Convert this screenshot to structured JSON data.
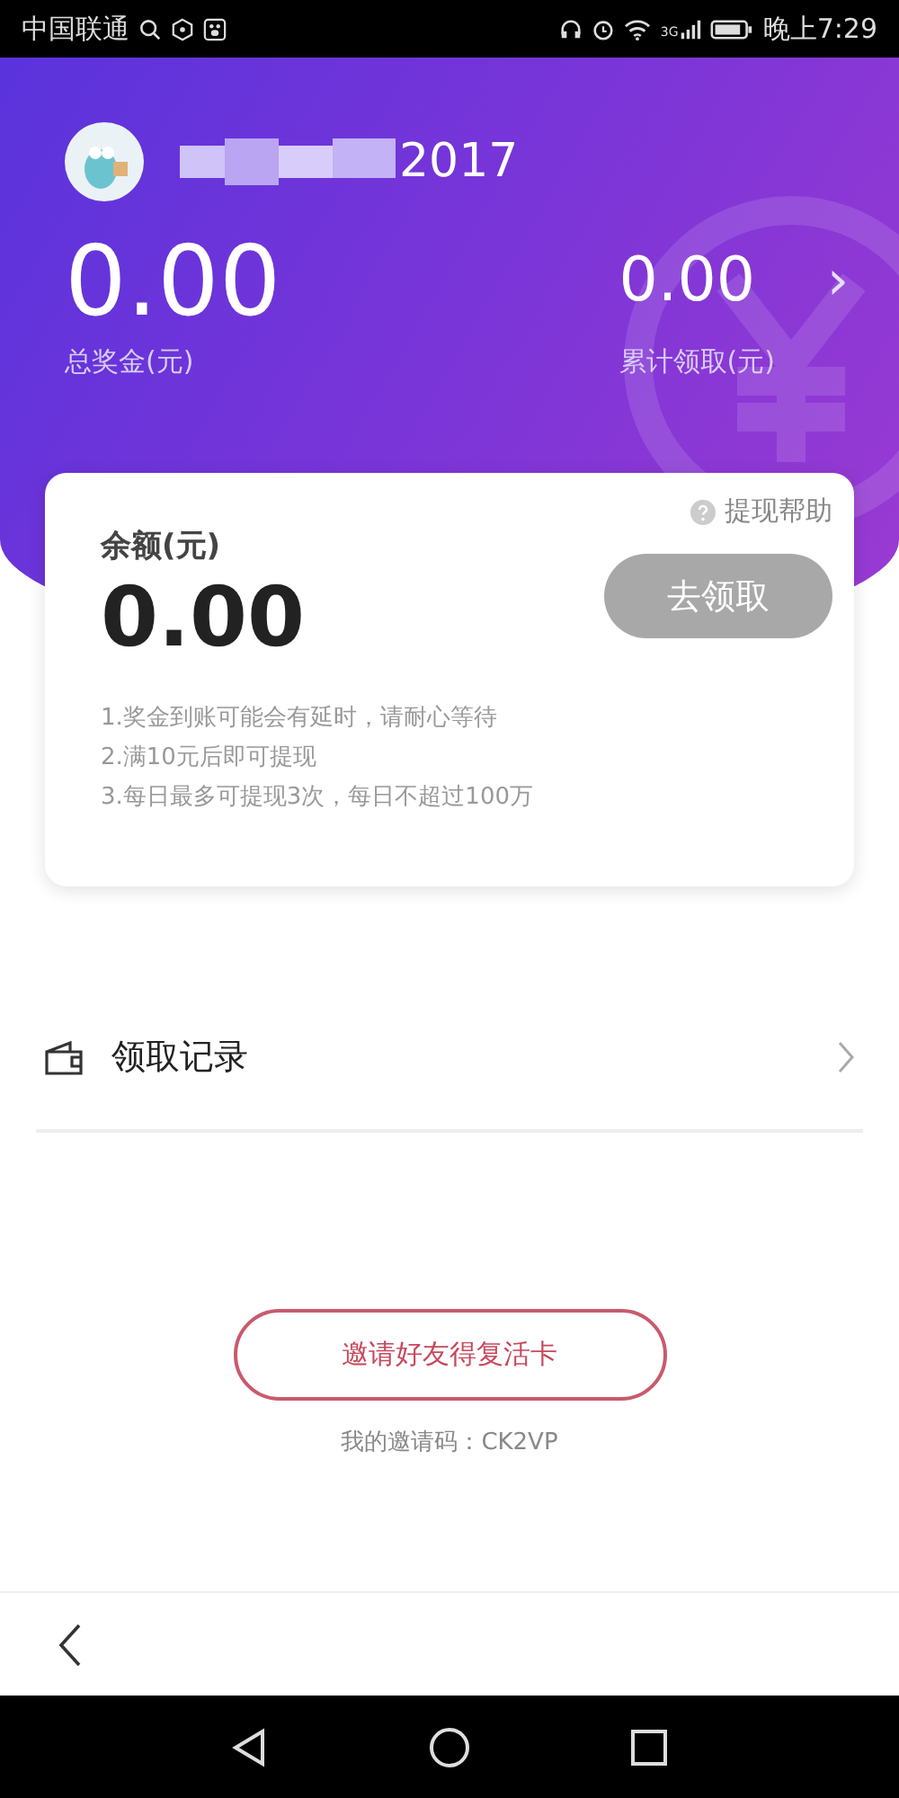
{
  "status_bar": {
    "carrier": "中国联通",
    "network": "3G",
    "time": "晚上7:29"
  },
  "header": {
    "username_visible": "2017",
    "total_bonus": {
      "amount": "0.00",
      "label": "总奖金(元)"
    },
    "total_claimed": {
      "amount": "0.00",
      "label": "累计领取(元)",
      "chevron": "›"
    }
  },
  "balance_card": {
    "help_link": "提现帮助",
    "label": "余额(元)",
    "amount": "0.00",
    "claim_button": {
      "label": "去领取",
      "disabled": true
    },
    "notes": [
      "1.奖金到账可能会有延时，请耐心等待",
      "2.满10元后即可提现",
      "3.每日最多可提现3次，每日不超过100万"
    ]
  },
  "records_row": {
    "label": "领取记录"
  },
  "invite": {
    "button": "邀请好友得复活卡",
    "code_text": "我的邀请码：CK2VP"
  }
}
